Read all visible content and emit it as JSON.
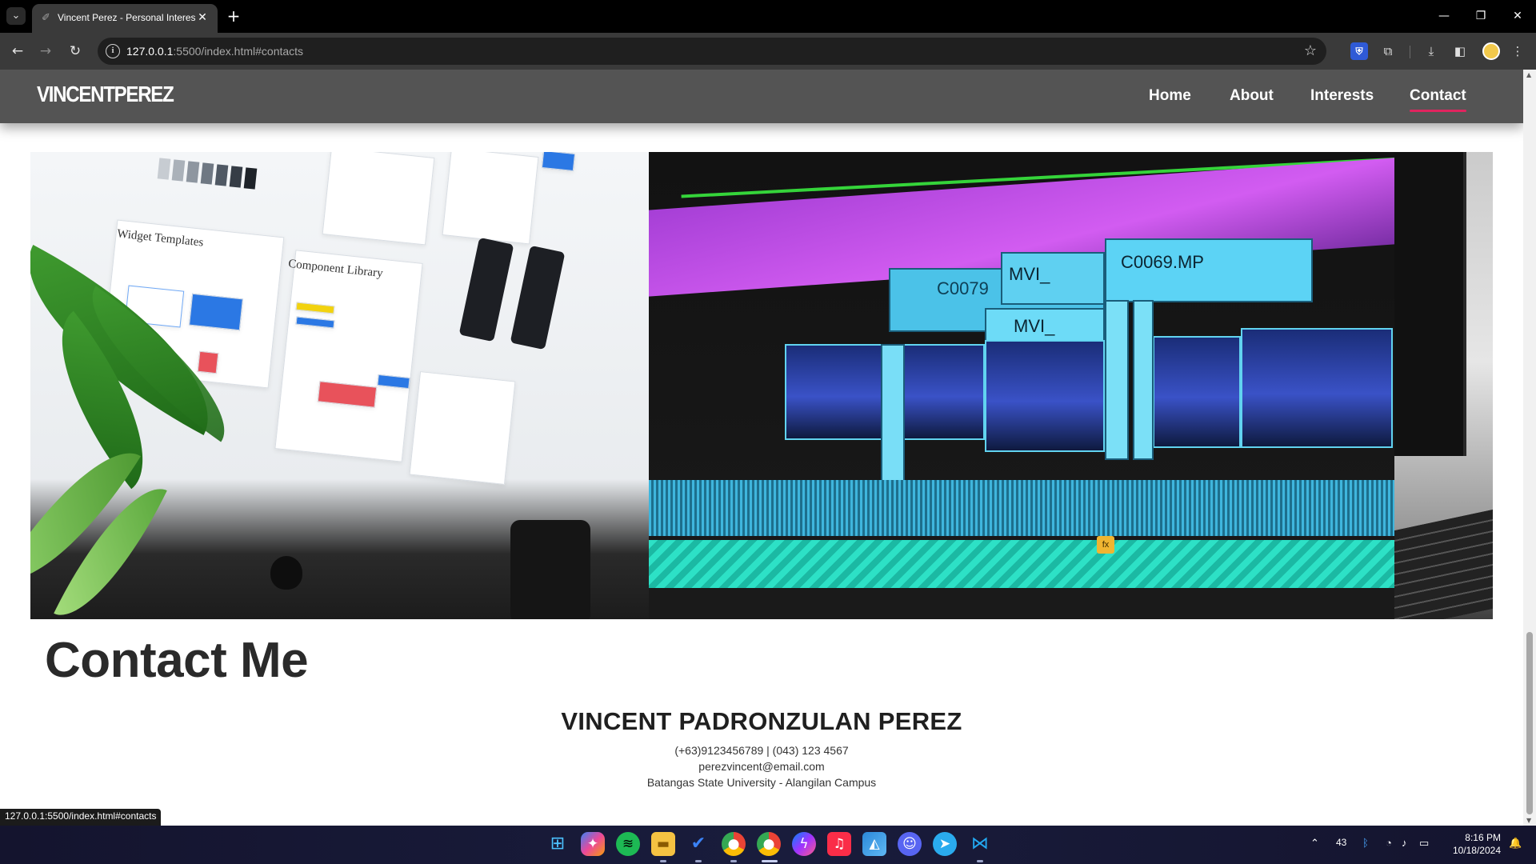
{
  "browser": {
    "tab_title": "Vincent Perez - Personal Interests",
    "url_host": "127.0.0.1",
    "url_rest": ":5500/index.html#contacts",
    "status_url": "127.0.0.1:5500/index.html#contacts"
  },
  "site": {
    "logo": "VINCENTPEREZ",
    "nav": [
      {
        "label": "Home"
      },
      {
        "label": "About"
      },
      {
        "label": "Interests"
      },
      {
        "label": "Contact"
      }
    ],
    "active_nav": "Contact"
  },
  "banner": {
    "ui_labels": [
      "Widget Templates",
      "Component Library"
    ],
    "video_labels": [
      "C0079",
      "MVI_",
      "C0069.MP",
      "MVI_"
    ]
  },
  "contact": {
    "title": "Contact Me",
    "name": "VINCENT PADRONZULAN PEREZ",
    "phones": "(+63)9123456789 | (043) 123 4567",
    "email": "perezvincent@email.com",
    "address": "Batangas State University - Alangilan Campus"
  },
  "taskbar": {
    "apps": [
      "windows-start",
      "copilot",
      "spotify",
      "file-explorer",
      "todo",
      "chrome",
      "chrome-profile",
      "messenger",
      "apple-music",
      "photos",
      "discord",
      "telegram",
      "vscode"
    ],
    "weather_temp": "43",
    "time": "8:16 PM",
    "date": "10/18/2024"
  },
  "colors": {
    "nav_bg": "#545454",
    "active_underline": "#e0245e",
    "taskbar_bg": "#191c3c"
  }
}
